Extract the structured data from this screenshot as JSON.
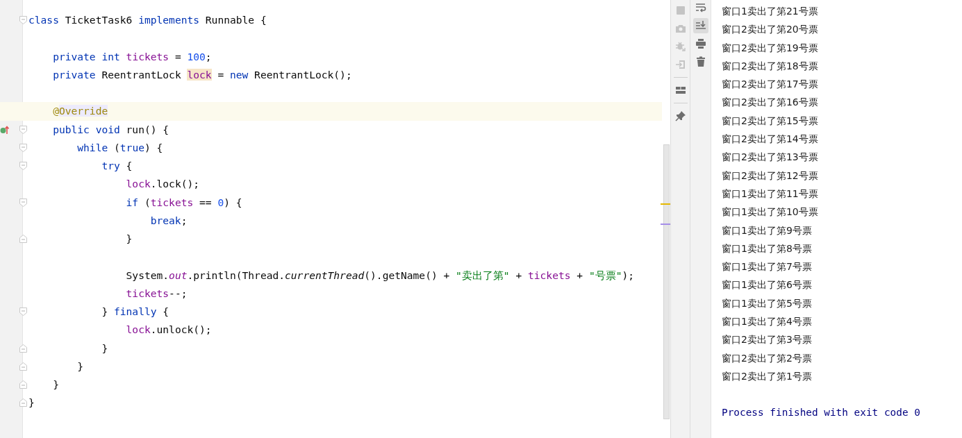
{
  "editor": {
    "lines": [
      {
        "kind": "code",
        "current": false,
        "fold_start": true,
        "fold_end": false,
        "override_mark": false,
        "tokens": [
          {
            "text": "class",
            "kind": "kw"
          },
          {
            "text": " TicketTask6 ",
            "kind": "plain"
          },
          {
            "text": "implements",
            "kind": "kw"
          },
          {
            "text": " Runnable {",
            "kind": "plain"
          }
        ]
      },
      {
        "kind": "blank",
        "current": false,
        "fold_start": false,
        "fold_end": false,
        "override_mark": false
      },
      {
        "kind": "code",
        "current": false,
        "fold_start": false,
        "fold_end": false,
        "override_mark": false,
        "tokens": [
          {
            "text": "    private int ",
            "kind": "kw"
          },
          {
            "text": "tickets",
            "kind": "field"
          },
          {
            "text": " = ",
            "kind": "plain"
          },
          {
            "text": "100",
            "kind": "num"
          },
          {
            "text": ";",
            "kind": "plain"
          }
        ]
      },
      {
        "kind": "code",
        "current": false,
        "fold_start": false,
        "fold_end": false,
        "override_mark": false,
        "tokens": [
          {
            "text": "    private",
            "kind": "kw"
          },
          {
            "text": " ReentrantLock ",
            "kind": "plain"
          },
          {
            "text": "lock",
            "kind": "field-marked"
          },
          {
            "text": " = ",
            "kind": "plain"
          },
          {
            "text": "new",
            "kind": "kw"
          },
          {
            "text": " ReentrantLock();",
            "kind": "plain"
          }
        ]
      },
      {
        "kind": "blank",
        "current": false,
        "fold_start": false,
        "fold_end": false,
        "override_mark": false
      },
      {
        "kind": "code",
        "current": true,
        "fold_start": false,
        "fold_end": false,
        "override_mark": false,
        "tokens": [
          {
            "text": "    @",
            "kind": "annotation"
          },
          {
            "text": "Override",
            "kind": "annotation-marked"
          }
        ]
      },
      {
        "kind": "code",
        "current": false,
        "fold_start": true,
        "fold_end": false,
        "override_mark": true,
        "tokens": [
          {
            "text": "    public void",
            "kind": "kw"
          },
          {
            "text": " run() {",
            "kind": "plain"
          }
        ]
      },
      {
        "kind": "code",
        "current": false,
        "fold_start": true,
        "fold_end": false,
        "override_mark": false,
        "tokens": [
          {
            "text": "        while",
            "kind": "kw"
          },
          {
            "text": " (",
            "kind": "plain"
          },
          {
            "text": "true",
            "kind": "kw"
          },
          {
            "text": ") {",
            "kind": "plain"
          }
        ]
      },
      {
        "kind": "code",
        "current": false,
        "fold_start": true,
        "fold_end": false,
        "override_mark": false,
        "tokens": [
          {
            "text": "            try",
            "kind": "kw"
          },
          {
            "text": " {",
            "kind": "plain"
          }
        ]
      },
      {
        "kind": "code",
        "current": false,
        "fold_start": false,
        "fold_end": false,
        "override_mark": false,
        "tokens": [
          {
            "text": "                lock",
            "kind": "field"
          },
          {
            "text": ".lock();",
            "kind": "plain"
          }
        ]
      },
      {
        "kind": "code",
        "current": false,
        "fold_start": true,
        "fold_end": false,
        "override_mark": false,
        "tokens": [
          {
            "text": "                if",
            "kind": "kw"
          },
          {
            "text": " (",
            "kind": "plain"
          },
          {
            "text": "tickets",
            "kind": "field"
          },
          {
            "text": " == ",
            "kind": "plain"
          },
          {
            "text": "0",
            "kind": "num"
          },
          {
            "text": ") {",
            "kind": "plain"
          }
        ]
      },
      {
        "kind": "code",
        "current": false,
        "fold_start": false,
        "fold_end": false,
        "override_mark": false,
        "tokens": [
          {
            "text": "                    break",
            "kind": "kw"
          },
          {
            "text": ";",
            "kind": "plain"
          }
        ]
      },
      {
        "kind": "code",
        "current": false,
        "fold_start": false,
        "fold_end": true,
        "override_mark": false,
        "tokens": [
          {
            "text": "                }",
            "kind": "plain"
          }
        ]
      },
      {
        "kind": "blank",
        "current": false,
        "fold_start": false,
        "fold_end": false,
        "override_mark": false
      },
      {
        "kind": "code",
        "current": false,
        "fold_start": false,
        "fold_end": false,
        "override_mark": false,
        "tokens": [
          {
            "text": "                System.",
            "kind": "plain"
          },
          {
            "text": "out",
            "kind": "static"
          },
          {
            "text": ".println(Thread.",
            "kind": "plain"
          },
          {
            "text": "currentThread",
            "kind": "italic"
          },
          {
            "text": "().getName() + ",
            "kind": "plain"
          },
          {
            "text": "\"卖出了第\"",
            "kind": "str"
          },
          {
            "text": " + ",
            "kind": "plain"
          },
          {
            "text": "tickets",
            "kind": "field"
          },
          {
            "text": " + ",
            "kind": "plain"
          },
          {
            "text": "\"号票\"",
            "kind": "str"
          },
          {
            "text": ");",
            "kind": "plain"
          }
        ]
      },
      {
        "kind": "code",
        "current": false,
        "fold_start": false,
        "fold_end": false,
        "override_mark": false,
        "tokens": [
          {
            "text": "                tickets",
            "kind": "field"
          },
          {
            "text": "--;",
            "kind": "plain"
          }
        ]
      },
      {
        "kind": "code",
        "current": false,
        "fold_start": true,
        "fold_end": false,
        "override_mark": false,
        "tokens": [
          {
            "text": "            } ",
            "kind": "plain"
          },
          {
            "text": "finally",
            "kind": "kw"
          },
          {
            "text": " {",
            "kind": "plain"
          }
        ]
      },
      {
        "kind": "code",
        "current": false,
        "fold_start": false,
        "fold_end": false,
        "override_mark": false,
        "tokens": [
          {
            "text": "                lock",
            "kind": "field"
          },
          {
            "text": ".unlock();",
            "kind": "plain"
          }
        ]
      },
      {
        "kind": "code",
        "current": false,
        "fold_start": false,
        "fold_end": true,
        "override_mark": false,
        "tokens": [
          {
            "text": "            }",
            "kind": "plain"
          }
        ]
      },
      {
        "kind": "code",
        "current": false,
        "fold_start": false,
        "fold_end": true,
        "override_mark": false,
        "tokens": [
          {
            "text": "        }",
            "kind": "plain"
          }
        ]
      },
      {
        "kind": "code",
        "current": false,
        "fold_start": false,
        "fold_end": true,
        "override_mark": false,
        "tokens": [
          {
            "text": "    }",
            "kind": "plain"
          }
        ]
      },
      {
        "kind": "code",
        "current": false,
        "fold_start": false,
        "fold_end": true,
        "override_mark": false,
        "tokens": [
          {
            "text": "}",
            "kind": "plain"
          }
        ]
      }
    ]
  },
  "run_toolbar": {
    "buttons": [
      {
        "kind": "stop",
        "disabled": true
      },
      {
        "kind": "camera",
        "disabled": true
      },
      {
        "kind": "bug",
        "disabled": true
      },
      {
        "kind": "login",
        "disabled": true
      },
      {
        "kind": "separator"
      },
      {
        "kind": "layout",
        "disabled": false
      },
      {
        "kind": "separator"
      },
      {
        "kind": "pin",
        "disabled": false
      }
    ]
  },
  "console_toolbar": {
    "buttons": [
      {
        "kind": "wrap",
        "selected": false
      },
      {
        "kind": "scroll-end",
        "selected": true
      },
      {
        "kind": "print",
        "selected": false
      },
      {
        "kind": "trash",
        "selected": false
      }
    ]
  },
  "console": {
    "lines": [
      {
        "text": "窗口1卖出了第21号票",
        "kind": "stdout"
      },
      {
        "text": "窗口2卖出了第20号票",
        "kind": "stdout"
      },
      {
        "text": "窗口2卖出了第19号票",
        "kind": "stdout"
      },
      {
        "text": "窗口2卖出了第18号票",
        "kind": "stdout"
      },
      {
        "text": "窗口2卖出了第17号票",
        "kind": "stdout"
      },
      {
        "text": "窗口2卖出了第16号票",
        "kind": "stdout"
      },
      {
        "text": "窗口2卖出了第15号票",
        "kind": "stdout"
      },
      {
        "text": "窗口2卖出了第14号票",
        "kind": "stdout"
      },
      {
        "text": "窗口2卖出了第13号票",
        "kind": "stdout"
      },
      {
        "text": "窗口2卖出了第12号票",
        "kind": "stdout"
      },
      {
        "text": "窗口1卖出了第11号票",
        "kind": "stdout"
      },
      {
        "text": "窗口1卖出了第10号票",
        "kind": "stdout"
      },
      {
        "text": "窗口1卖出了第9号票",
        "kind": "stdout"
      },
      {
        "text": "窗口1卖出了第8号票",
        "kind": "stdout"
      },
      {
        "text": "窗口1卖出了第7号票",
        "kind": "stdout"
      },
      {
        "text": "窗口1卖出了第6号票",
        "kind": "stdout"
      },
      {
        "text": "窗口1卖出了第5号票",
        "kind": "stdout"
      },
      {
        "text": "窗口1卖出了第4号票",
        "kind": "stdout"
      },
      {
        "text": "窗口2卖出了第3号票",
        "kind": "stdout"
      },
      {
        "text": "窗口2卖出了第2号票",
        "kind": "stdout"
      },
      {
        "text": "窗口2卖出了第1号票",
        "kind": "stdout"
      },
      {
        "text": "Process finished with exit code 0",
        "kind": "system"
      }
    ]
  }
}
